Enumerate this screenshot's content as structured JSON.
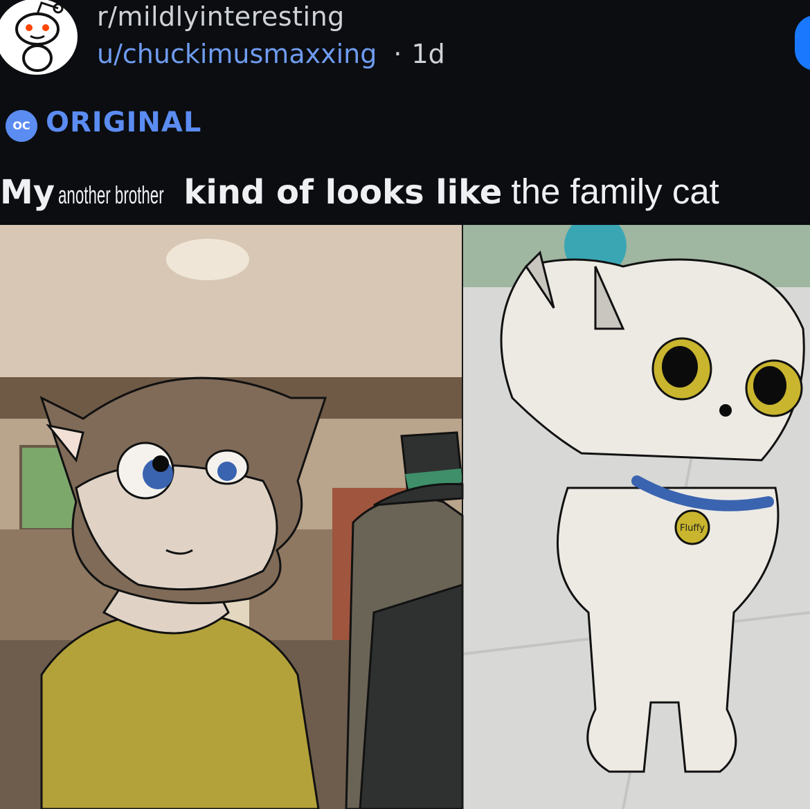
{
  "post": {
    "subreddit": "r/mildlyinteresting",
    "username": "u/chuckimusmaxxing",
    "separator": "·",
    "age": "1d",
    "flair_badge": "OC",
    "flair": "ORIGINAL",
    "title": {
      "part1": "My",
      "part2_handwritten": "another brother",
      "part3": "kind of looks like",
      "part4_added": "the family cat"
    }
  },
  "image": {
    "cat_tag_text": "Fluffy"
  },
  "colors": {
    "background": "#0b0d11",
    "link_blue": "#6f9cf0",
    "flair_blue": "#5b8cf2",
    "join_blue": "#1a78ff"
  },
  "icons": {
    "avatar": "reddit-snoo-icon"
  }
}
